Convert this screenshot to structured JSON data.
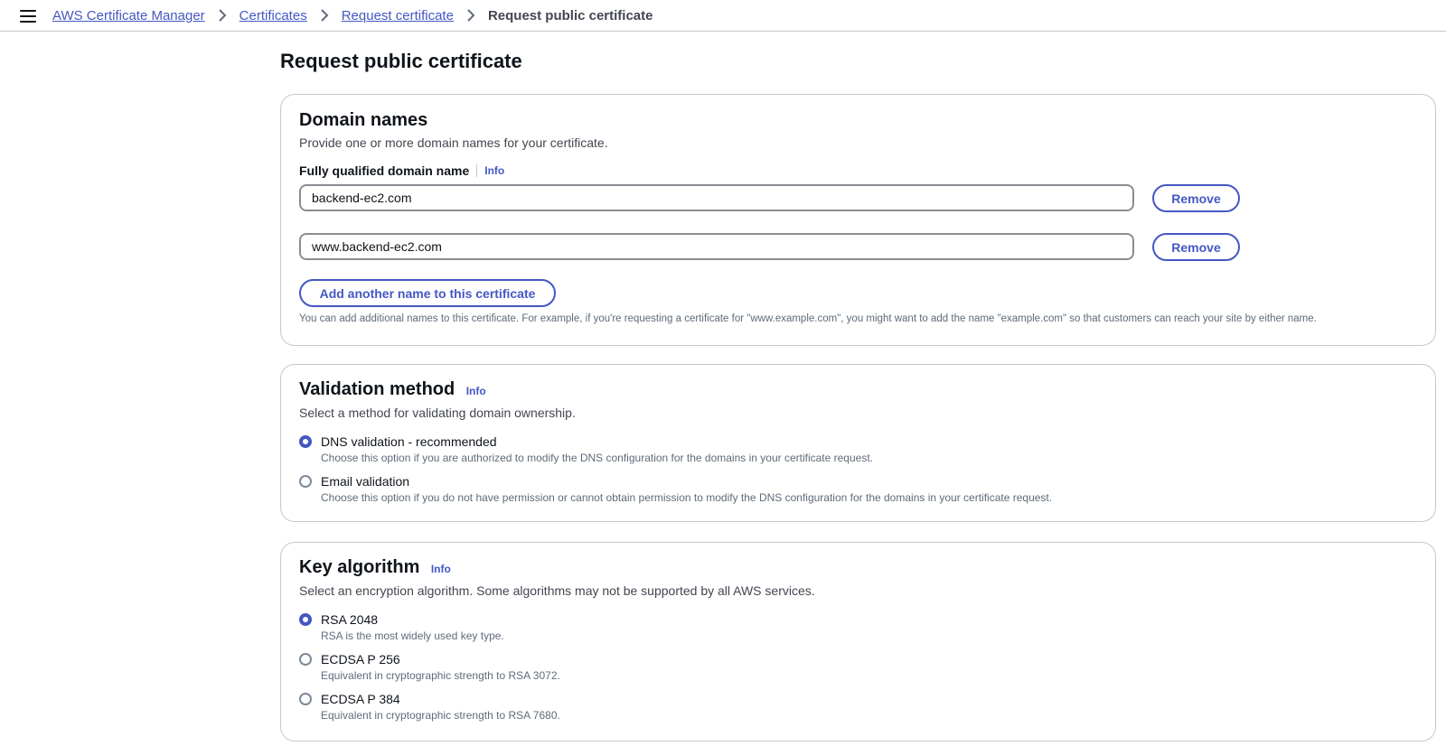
{
  "breadcrumb": {
    "items": [
      "AWS Certificate Manager",
      "Certificates",
      "Request certificate"
    ],
    "current": "Request public certificate"
  },
  "page": {
    "title": "Request public certificate"
  },
  "domain_names": {
    "title": "Domain names",
    "description": "Provide one or more domain names for your certificate.",
    "field_label": "Fully qualified domain name",
    "info": "Info",
    "domains": [
      "backend-ec2.com",
      "www.backend-ec2.com"
    ],
    "remove_label": "Remove",
    "add_button": "Add another name to this certificate",
    "hint": "You can add additional names to this certificate. For example, if you're requesting a certificate for \"www.example.com\", you might want to add the name \"example.com\" so that customers can reach your site by either name."
  },
  "validation": {
    "title": "Validation method",
    "info": "Info",
    "description": "Select a method for validating domain ownership.",
    "options": [
      {
        "label": "DNS validation - recommended",
        "desc": "Choose this option if you are authorized to modify the DNS configuration for the domains in your certificate request.",
        "checked": true
      },
      {
        "label": "Email validation",
        "desc": "Choose this option if you do not have permission or cannot obtain permission to modify the DNS configuration for the domains in your certificate request.",
        "checked": false
      }
    ]
  },
  "key_algorithm": {
    "title": "Key algorithm",
    "info": "Info",
    "description": "Select an encryption algorithm. Some algorithms may not be supported by all AWS services.",
    "options": [
      {
        "label": "RSA 2048",
        "desc": "RSA is the most widely used key type.",
        "checked": true
      },
      {
        "label": "ECDSA P 256",
        "desc": "Equivalent in cryptographic strength to RSA 3072.",
        "checked": false
      },
      {
        "label": "ECDSA P 384",
        "desc": "Equivalent in cryptographic strength to RSA 7680.",
        "checked": false
      }
    ]
  },
  "colors": {
    "accent": "#4457c4",
    "border": "#c6c6cd"
  }
}
